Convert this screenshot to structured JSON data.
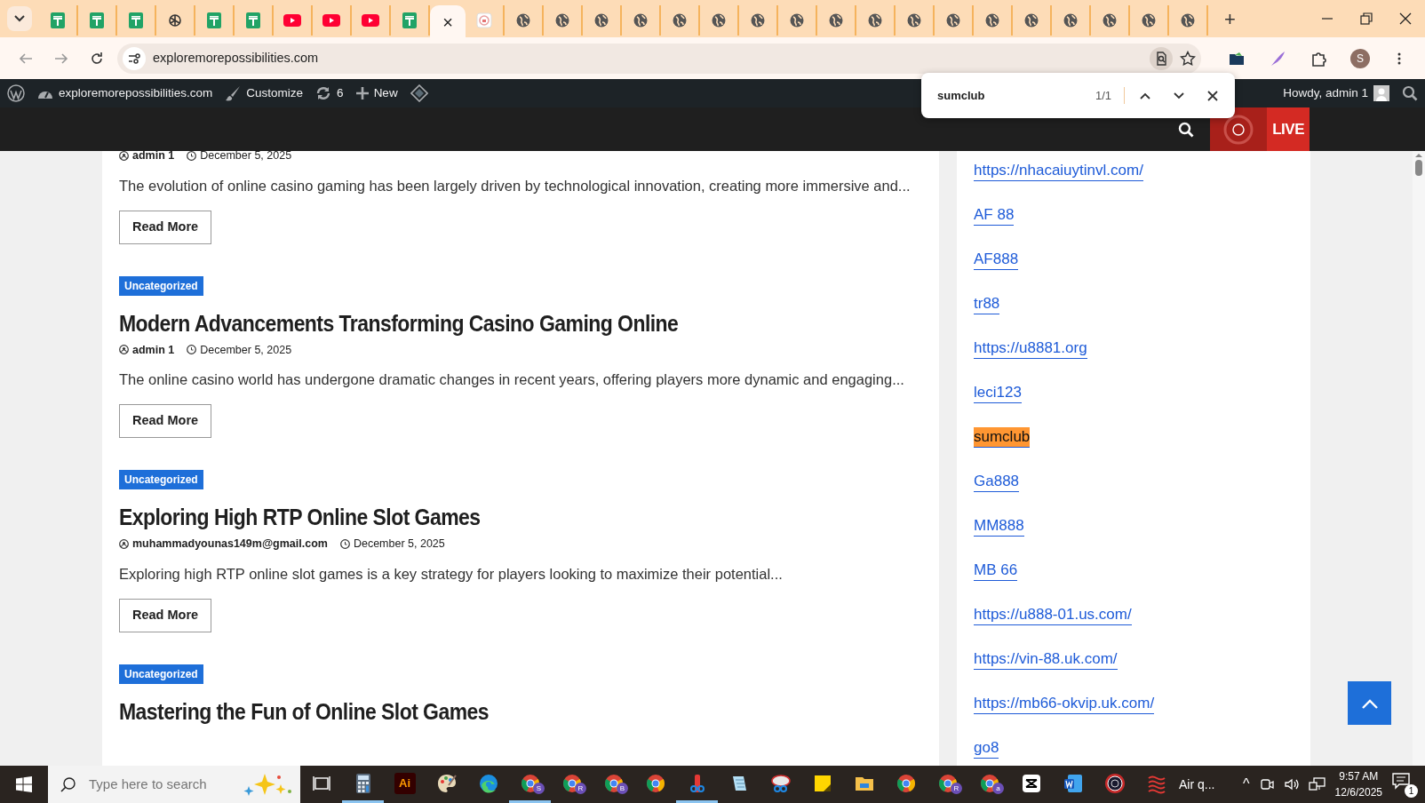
{
  "browser": {
    "tabs": [
      {
        "kind": "sheets",
        "selected": false
      },
      {
        "kind": "sheets",
        "selected": false
      },
      {
        "kind": "sheets",
        "selected": false
      },
      {
        "kind": "knot",
        "selected": false
      },
      {
        "kind": "sheets",
        "selected": false
      },
      {
        "kind": "sheets",
        "selected": false
      },
      {
        "kind": "video",
        "selected": false
      },
      {
        "kind": "video",
        "selected": false
      },
      {
        "kind": "video",
        "selected": false
      },
      {
        "kind": "sheets",
        "selected": false
      },
      {
        "kind": "close",
        "selected": true,
        "close": "×"
      },
      {
        "kind": "page",
        "selected": false
      },
      {
        "kind": "globe",
        "selected": false
      },
      {
        "kind": "globe",
        "selected": false
      },
      {
        "kind": "globe",
        "selected": false
      },
      {
        "kind": "globe",
        "selected": false
      },
      {
        "kind": "globe",
        "selected": false
      },
      {
        "kind": "globe",
        "selected": false
      },
      {
        "kind": "globe",
        "selected": false
      },
      {
        "kind": "globe",
        "selected": false
      },
      {
        "kind": "globe",
        "selected": false
      },
      {
        "kind": "globe",
        "selected": false
      },
      {
        "kind": "globe",
        "selected": false
      },
      {
        "kind": "globe",
        "selected": false
      },
      {
        "kind": "globe",
        "selected": false
      },
      {
        "kind": "globe",
        "selected": false
      },
      {
        "kind": "globe",
        "selected": false
      },
      {
        "kind": "globe",
        "selected": false
      },
      {
        "kind": "globe",
        "selected": false
      },
      {
        "kind": "globe",
        "selected": false
      }
    ],
    "new_tab": "+",
    "address": "exploremorepossibilities.com",
    "profile": "S"
  },
  "find_bar": {
    "query": "sumclub",
    "count": "1/1"
  },
  "admin_bar": {
    "site": "exploremorepossibilities.com",
    "customize": "Customize",
    "updates": "6",
    "new": "New",
    "greeting": "Howdy, admin 1"
  },
  "header": {
    "live": "LIVE"
  },
  "posts": [
    {
      "author": "admin 1",
      "date": "December 5, 2025",
      "excerpt": "The evolution of online casino gaming has been largely driven by technological innovation, creating more immersive and...",
      "button": "Read More"
    },
    {
      "category": "Uncategorized",
      "title": "Modern Advancements Transforming Casino Gaming Online",
      "author": "admin 1",
      "date": "December 5, 2025",
      "excerpt": "The online casino world has undergone dramatic changes in recent years, offering players more dynamic and engaging...",
      "button": "Read More"
    },
    {
      "category": "Uncategorized",
      "title": "Exploring High RTP Online Slot Games",
      "author": "muhammadyounas149m@gmail.com",
      "date": "December 5, 2025",
      "excerpt": "Exploring high RTP online slot games is a key strategy for players looking to maximize their potential...",
      "button": "Read More"
    },
    {
      "category": "Uncategorized",
      "title": "Mastering the Fun of Online Slot Games"
    }
  ],
  "sidebar": {
    "links": [
      {
        "text": "https://nhacaiuytinvl.com/",
        "highlighted": false
      },
      {
        "text": "AF 88",
        "highlighted": false
      },
      {
        "text": "AF888",
        "highlighted": false
      },
      {
        "text": "tr88",
        "highlighted": false
      },
      {
        "text": "https://u8881.org",
        "highlighted": false
      },
      {
        "text": "leci123",
        "highlighted": false
      },
      {
        "text": "sumclub",
        "highlighted": true
      },
      {
        "text": "Ga888",
        "highlighted": false
      },
      {
        "text": "MM888",
        "highlighted": false
      },
      {
        "text": "MB 66",
        "highlighted": false
      },
      {
        "text": "https://u888-01.us.com/",
        "highlighted": false
      },
      {
        "text": "https://vin-88.uk.com/",
        "highlighted": false
      },
      {
        "text": "https://mb66-okvip.uk.com/",
        "highlighted": false
      },
      {
        "text": "go8",
        "highlighted": false
      }
    ]
  },
  "taskbar": {
    "search_placeholder": "Type here to search",
    "apps": [
      {
        "kind": "taskview",
        "active": false
      },
      {
        "kind": "calculator",
        "active": true
      },
      {
        "kind": "illustrator",
        "active": false,
        "label": "Ai"
      },
      {
        "kind": "paint",
        "active": false
      },
      {
        "kind": "edge",
        "active": false
      },
      {
        "kind": "chrome",
        "active": true,
        "badge": "S"
      },
      {
        "kind": "chrome",
        "active": false,
        "badge": "R"
      },
      {
        "kind": "chrome",
        "active": false,
        "badge": "B"
      },
      {
        "kind": "chrome",
        "active": false
      },
      {
        "kind": "snip",
        "active": true
      },
      {
        "kind": "notepad",
        "active": false
      },
      {
        "kind": "scissors",
        "active": false
      },
      {
        "kind": "sticky",
        "active": false
      },
      {
        "kind": "folder",
        "active": false
      },
      {
        "kind": "chrome",
        "active": false
      },
      {
        "kind": "chrome",
        "active": false,
        "badge": "R"
      },
      {
        "kind": "chrome",
        "active": false,
        "badge": "a"
      },
      {
        "kind": "capcut",
        "active": false
      },
      {
        "kind": "word",
        "active": false
      },
      {
        "kind": "seal",
        "active": false
      },
      {
        "kind": "weather",
        "active": false
      }
    ],
    "weather": "Air q...",
    "caret": "^",
    "time": "9:57 AM",
    "date": "12/6/2025",
    "notifications": "1"
  }
}
